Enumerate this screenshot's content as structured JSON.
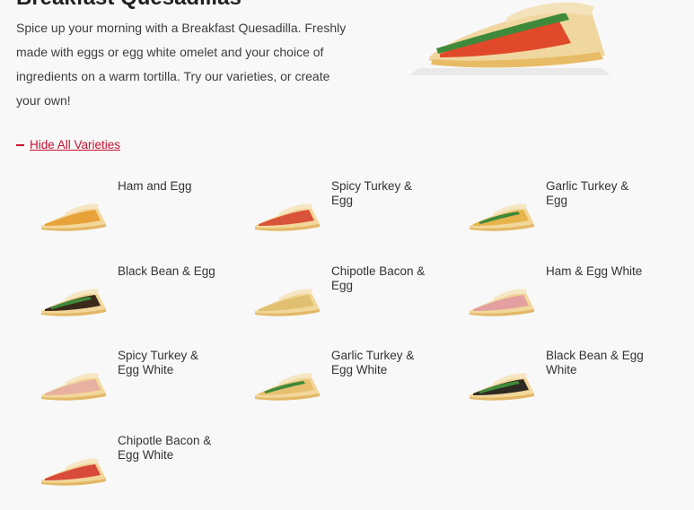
{
  "page": {
    "title": "Breakfast Quesadillas",
    "description": "Spice up your morning with a Breakfast Quesadilla. Freshly made with eggs or egg white omelet and your choice of ingredients on a warm tortilla. Try our varieties, or create your own!",
    "toggle_label": "Hide All Varieties"
  },
  "varieties": [
    {
      "name": "Ham and Egg",
      "filling": "#e8a23a",
      "green": false
    },
    {
      "name": "Spicy Turkey & Egg",
      "filling": "#d9533a",
      "green": false
    },
    {
      "name": "Garlic Turkey & Egg",
      "filling": "#e6b44a",
      "green": true
    },
    {
      "name": "Black Bean & Egg",
      "filling": "#3a2a1a",
      "green": true
    },
    {
      "name": "Chipotle Bacon & Egg",
      "filling": "#e0c070",
      "green": false
    },
    {
      "name": "Ham & Egg White",
      "filling": "#e4a0a0",
      "green": false
    },
    {
      "name": "Spicy Turkey & Egg White",
      "filling": "#e8b0a0",
      "green": false
    },
    {
      "name": "Garlic Turkey & Egg White",
      "filling": "#e8c070",
      "green": true
    },
    {
      "name": "Black Bean & Egg White",
      "filling": "#2e2a22",
      "green": true
    },
    {
      "name": "Chipotle Bacon & Egg White",
      "filling": "#d84a3a",
      "green": false
    }
  ],
  "colors": {
    "accent": "#c8102e",
    "tortilla": "#f2d79a",
    "tortilla_edge": "#e3b865"
  }
}
